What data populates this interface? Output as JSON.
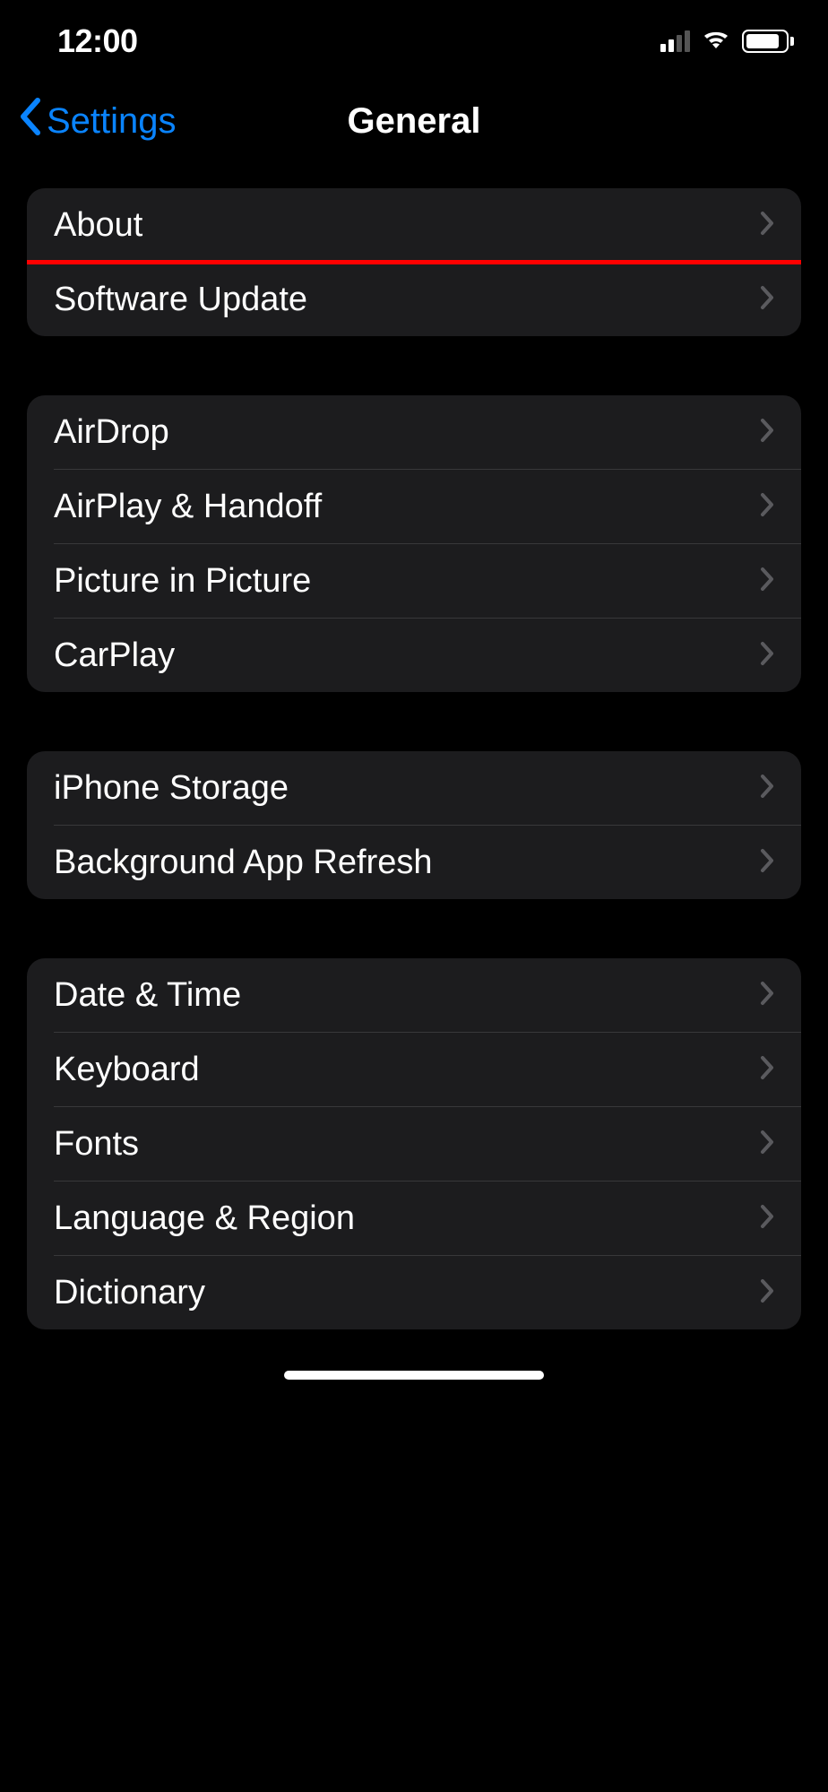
{
  "statusBar": {
    "time": "12:00"
  },
  "nav": {
    "backLabel": "Settings",
    "title": "General"
  },
  "sections": [
    {
      "rows": [
        {
          "label": "About",
          "id": "about"
        },
        {
          "label": "Software Update",
          "id": "software-update",
          "highlighted": true
        }
      ]
    },
    {
      "rows": [
        {
          "label": "AirDrop",
          "id": "airdrop"
        },
        {
          "label": "AirPlay & Handoff",
          "id": "airplay-handoff"
        },
        {
          "label": "Picture in Picture",
          "id": "picture-in-picture"
        },
        {
          "label": "CarPlay",
          "id": "carplay"
        }
      ]
    },
    {
      "rows": [
        {
          "label": "iPhone Storage",
          "id": "iphone-storage"
        },
        {
          "label": "Background App Refresh",
          "id": "background-app-refresh"
        }
      ]
    },
    {
      "rows": [
        {
          "label": "Date & Time",
          "id": "date-time"
        },
        {
          "label": "Keyboard",
          "id": "keyboard"
        },
        {
          "label": "Fonts",
          "id": "fonts"
        },
        {
          "label": "Language & Region",
          "id": "language-region"
        },
        {
          "label": "Dictionary",
          "id": "dictionary"
        }
      ]
    }
  ]
}
